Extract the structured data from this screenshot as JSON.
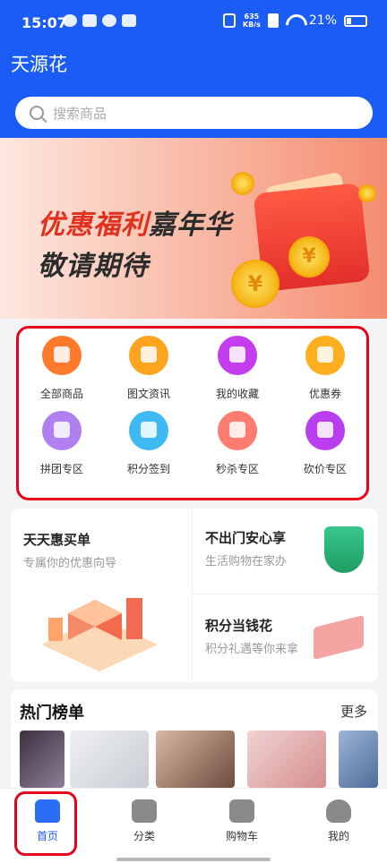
{
  "status_bar": {
    "time": "15:07",
    "speed_top": "635",
    "speed_bottom": "KB/s",
    "battery": "21%"
  },
  "header": {
    "title": "天源花"
  },
  "search": {
    "placeholder": "搜索商品"
  },
  "banner": {
    "line1_red": "优惠福利",
    "line1_dark": "嘉年华",
    "line2": "敬请期待",
    "coin_symbol": "¥"
  },
  "grid": {
    "items": [
      {
        "label": "全部商品",
        "icon": "store-icon",
        "color": "#ff7a2a"
      },
      {
        "label": "图文资讯",
        "icon": "article-icon",
        "color": "#ffa41f"
      },
      {
        "label": "我的收藏",
        "icon": "favorite-icon",
        "color": "#c43ef0"
      },
      {
        "label": "优惠券",
        "icon": "coupon-icon",
        "color": "#ffae1f"
      },
      {
        "label": "拼团专区",
        "icon": "group-buy-icon",
        "color": "#b07ff0"
      },
      {
        "label": "积分签到",
        "icon": "checkin-icon",
        "color": "#3fb9f4"
      },
      {
        "label": "秒杀专区",
        "icon": "alarm-clock-icon",
        "color": "#ff7d70"
      },
      {
        "label": "砍价专区",
        "icon": "bargain-icon",
        "color": "#b93ef0"
      }
    ]
  },
  "promo": {
    "left_title": "天天惠买单",
    "left_sub": "专属你的优惠向导",
    "right_top_title": "不出门安心享",
    "right_top_sub": "生活购物在家办",
    "right_bottom_title": "积分当钱花",
    "right_bottom_sub": "积分礼遇等你来拿"
  },
  "hot": {
    "title": "热门榜单",
    "more": "更多"
  },
  "tabbar": {
    "tabs": [
      {
        "label": "首页",
        "icon": "home-store-icon",
        "active": true
      },
      {
        "label": "分类",
        "icon": "category-grid-icon",
        "active": false
      },
      {
        "label": "购物车",
        "icon": "cart-icon",
        "active": false
      },
      {
        "label": "我的",
        "icon": "user-icon",
        "active": false
      }
    ]
  },
  "colors": {
    "primary": "#1a5cf5",
    "highlight_border": "#e8001c",
    "banner_red": "#e0301e"
  }
}
